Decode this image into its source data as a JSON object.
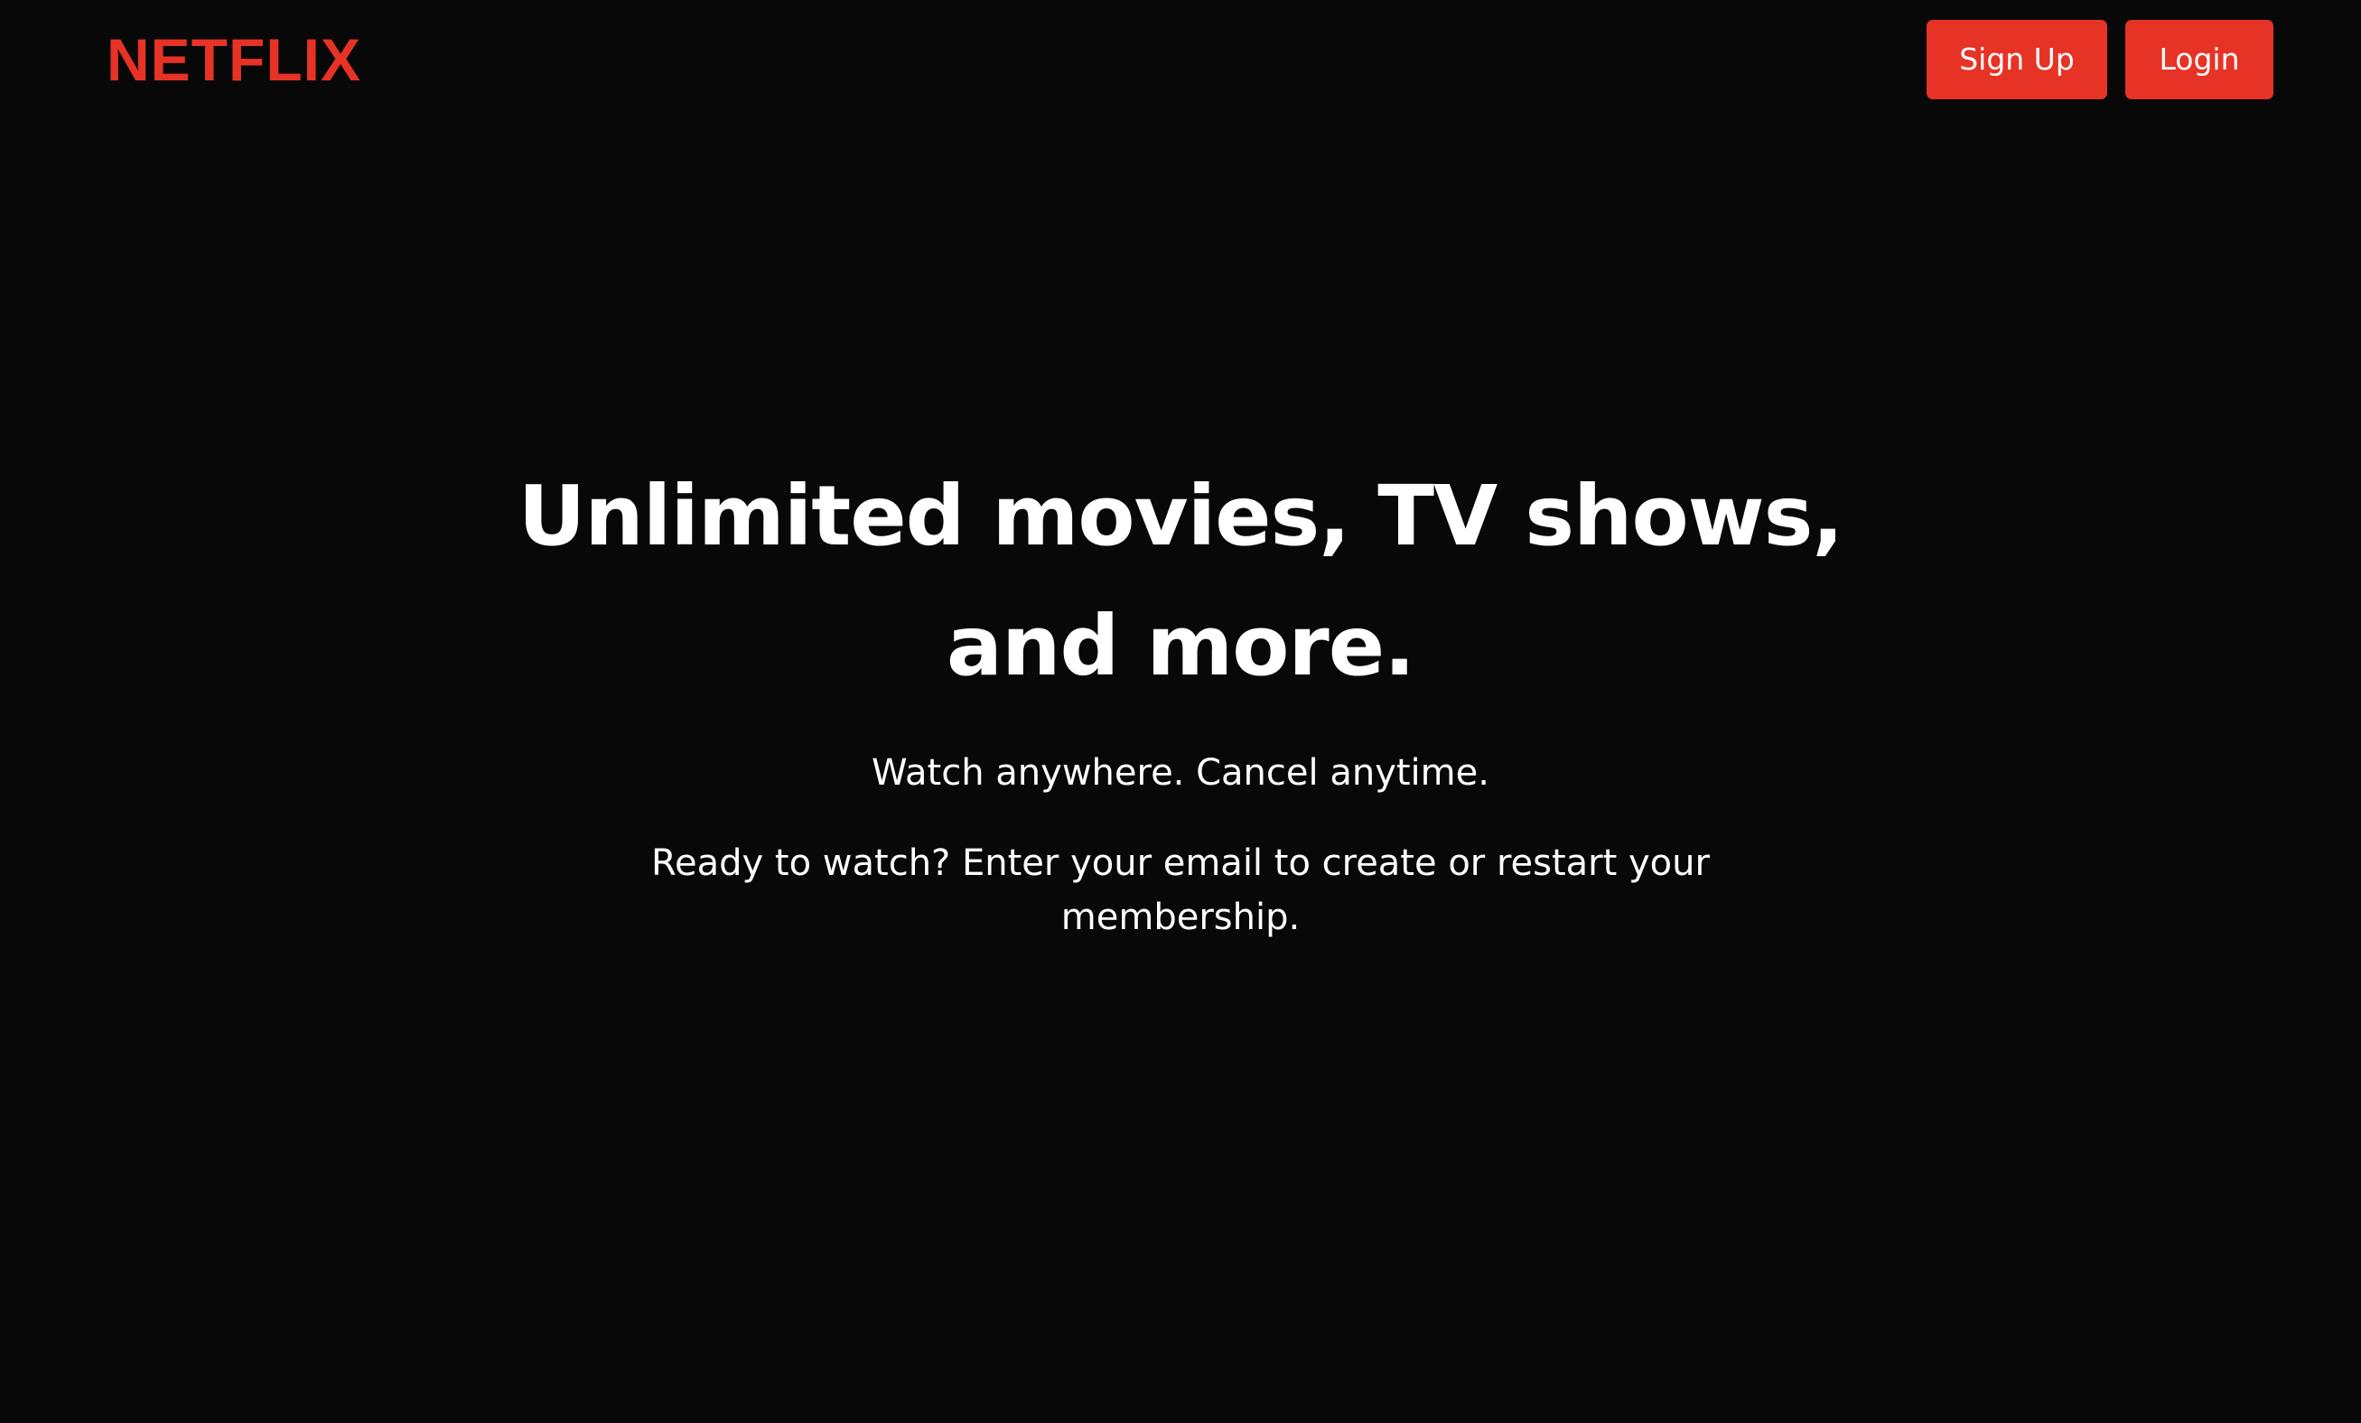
{
  "header": {
    "logo_text": "NETFLIX",
    "signup_label": "Sign Up",
    "login_label": "Login"
  },
  "hero": {
    "headline": "Unlimited movies, TV shows, and more.",
    "tagline": "Watch anywhere. Cancel anytime.",
    "prompt": "Ready to watch? Enter your email to create or restart your membership."
  },
  "colors": {
    "background": "#080808",
    "accent": "#e63326",
    "text": "#ffffff"
  }
}
